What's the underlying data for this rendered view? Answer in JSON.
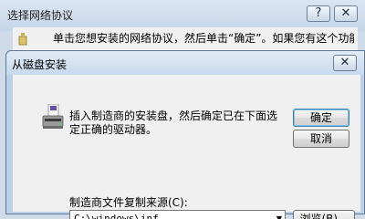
{
  "parent": {
    "title": "选择网络协议",
    "help_label": "?",
    "close_label": "✕",
    "instruction": "单击您想安装的网络协议，然后单击“确定”。如果您有这个功能的"
  },
  "dialog": {
    "title": "从磁盘安装",
    "close_label": "✕",
    "instruction": "插入制造商的安装盘，然后确定已在下面选定正确的驱动器。",
    "ok_label": "确定",
    "cancel_label": "取消",
    "source_label": "制造商文件复制来源(C):",
    "source_value": "C:\\windows\\inf",
    "browse_label": "浏览(B)...",
    "icon": "disk-drive-icon"
  }
}
